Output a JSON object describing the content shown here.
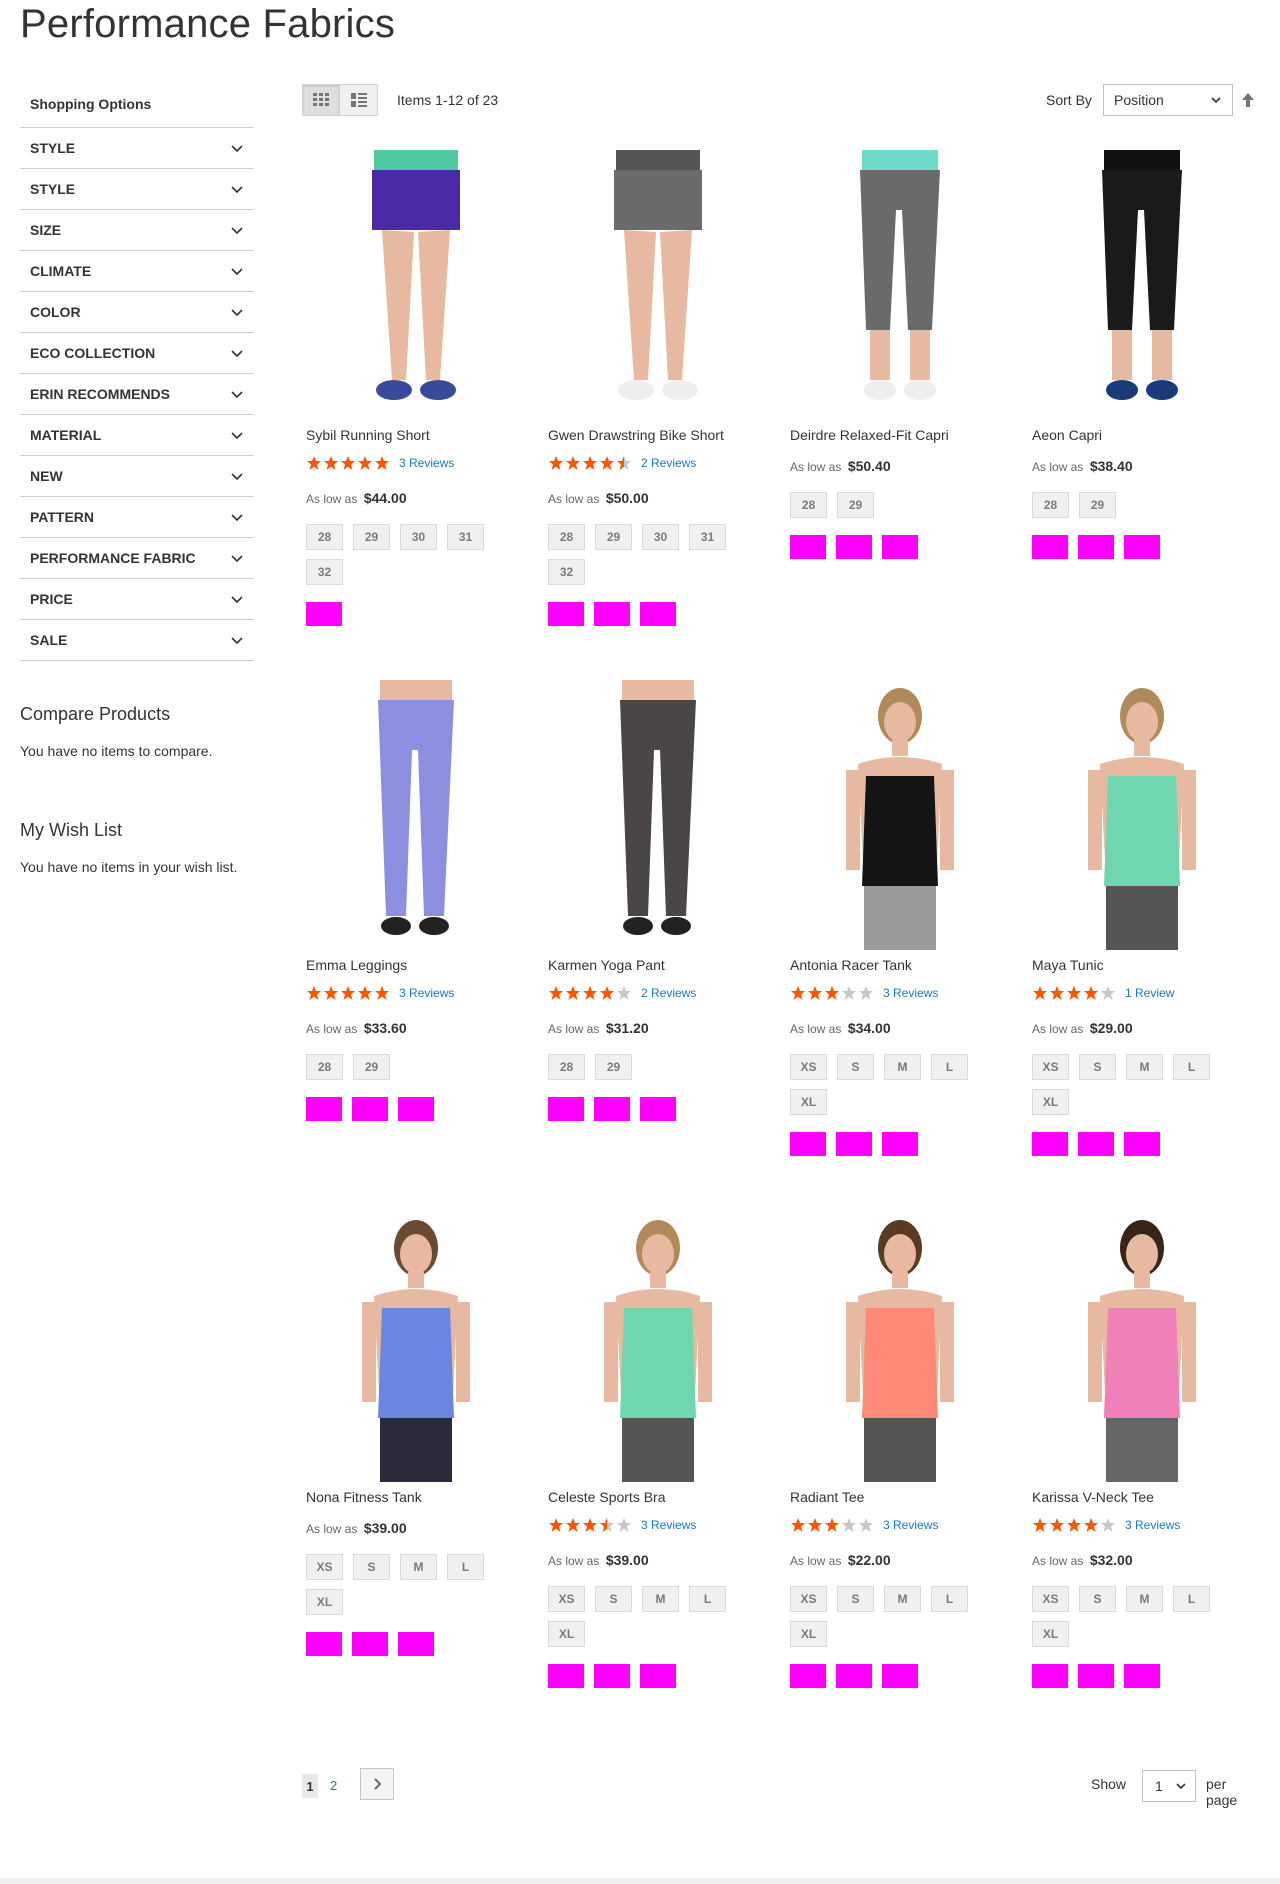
{
  "page": {
    "title": "Performance Fabrics"
  },
  "sidebar": {
    "title": "Shopping Options",
    "filters": [
      "STYLE",
      "STYLE",
      "SIZE",
      "CLIMATE",
      "COLOR",
      "ECO COLLECTION",
      "ERIN RECOMMENDS",
      "MATERIAL",
      "NEW",
      "PATTERN",
      "PERFORMANCE FABRIC",
      "PRICE",
      "SALE"
    ],
    "compare": {
      "title": "Compare Products",
      "text": "You have no items to compare."
    },
    "wishlist": {
      "title": "My Wish List",
      "text": "You have no items in your wish list."
    }
  },
  "toolbar": {
    "items_count": "Items 1-12 of 23",
    "sort_label": "Sort By",
    "sort_value": "Position"
  },
  "products": [
    {
      "name": "Sybil Running Short",
      "rating": 5,
      "reviews": "3 Reviews",
      "price_label": "As low as",
      "price": "$44.00",
      "sizes": [
        "28",
        "29",
        "30",
        "31",
        "32"
      ],
      "colors": 1
    },
    {
      "name": "Gwen Drawstring Bike Short",
      "rating": 4.5,
      "reviews": "2 Reviews",
      "price_label": "As low as",
      "price": "$50.00",
      "sizes": [
        "28",
        "29",
        "30",
        "31",
        "32"
      ],
      "colors": 3
    },
    {
      "name": "Deirdre Relaxed-Fit Capri",
      "rating": 0,
      "reviews": "",
      "price_label": "As low as",
      "price": "$50.40",
      "sizes": [
        "28",
        "29"
      ],
      "colors": 3
    },
    {
      "name": "Aeon Capri",
      "rating": 0,
      "reviews": "",
      "price_label": "As low as",
      "price": "$38.40",
      "sizes": [
        "28",
        "29"
      ],
      "colors": 3
    },
    {
      "name": "Emma Leggings",
      "rating": 5,
      "reviews": "3 Reviews",
      "price_label": "As low as",
      "price": "$33.60",
      "sizes": [
        "28",
        "29"
      ],
      "colors": 3
    },
    {
      "name": "Karmen Yoga Pant",
      "rating": 4,
      "reviews": "2 Reviews",
      "price_label": "As low as",
      "price": "$31.20",
      "sizes": [
        "28",
        "29"
      ],
      "colors": 3
    },
    {
      "name": "Antonia Racer Tank",
      "rating": 3,
      "reviews": "3 Reviews",
      "price_label": "As low as",
      "price": "$34.00",
      "sizes": [
        "XS",
        "S",
        "M",
        "L",
        "XL"
      ],
      "colors": 3
    },
    {
      "name": "Maya Tunic",
      "rating": 4,
      "reviews": "1 Review",
      "price_label": "As low as",
      "price": "$29.00",
      "sizes": [
        "XS",
        "S",
        "M",
        "L",
        "XL"
      ],
      "colors": 3
    },
    {
      "name": "Nona Fitness Tank",
      "rating": 0,
      "reviews": "",
      "price_label": "As low as",
      "price": "$39.00",
      "sizes": [
        "XS",
        "S",
        "M",
        "L",
        "XL"
      ],
      "colors": 3
    },
    {
      "name": "Celeste Sports Bra",
      "rating": 3.5,
      "reviews": "3 Reviews",
      "price_label": "As low as",
      "price": "$39.00",
      "sizes": [
        "XS",
        "S",
        "M",
        "L",
        "XL"
      ],
      "colors": 3
    },
    {
      "name": "Radiant Tee",
      "rating": 3,
      "reviews": "3 Reviews",
      "price_label": "As low as",
      "price": "$22.00",
      "sizes": [
        "XS",
        "S",
        "M",
        "L",
        "XL"
      ],
      "colors": 3
    },
    {
      "name": "Karissa V-Neck Tee",
      "rating": 4,
      "reviews": "3 Reviews",
      "price_label": "As low as",
      "price": "$32.00",
      "sizes": [
        "XS",
        "S",
        "M",
        "L",
        "XL"
      ],
      "colors": 3
    }
  ],
  "pager": {
    "current": "1",
    "next_page": "2",
    "show_label": "Show",
    "limit_value": "1",
    "per_page_label": "per page"
  },
  "colors": {
    "swatch": "#ff00ff",
    "star_on": "#ff5501",
    "star_off": "#c7c7c7",
    "link": "#1979c3"
  },
  "icons": {
    "grid": "grid-icon",
    "list": "list-icon",
    "chevron": "chevron-down-icon",
    "sort_dir": "arrow-up-icon",
    "next": "chevron-right-icon"
  }
}
